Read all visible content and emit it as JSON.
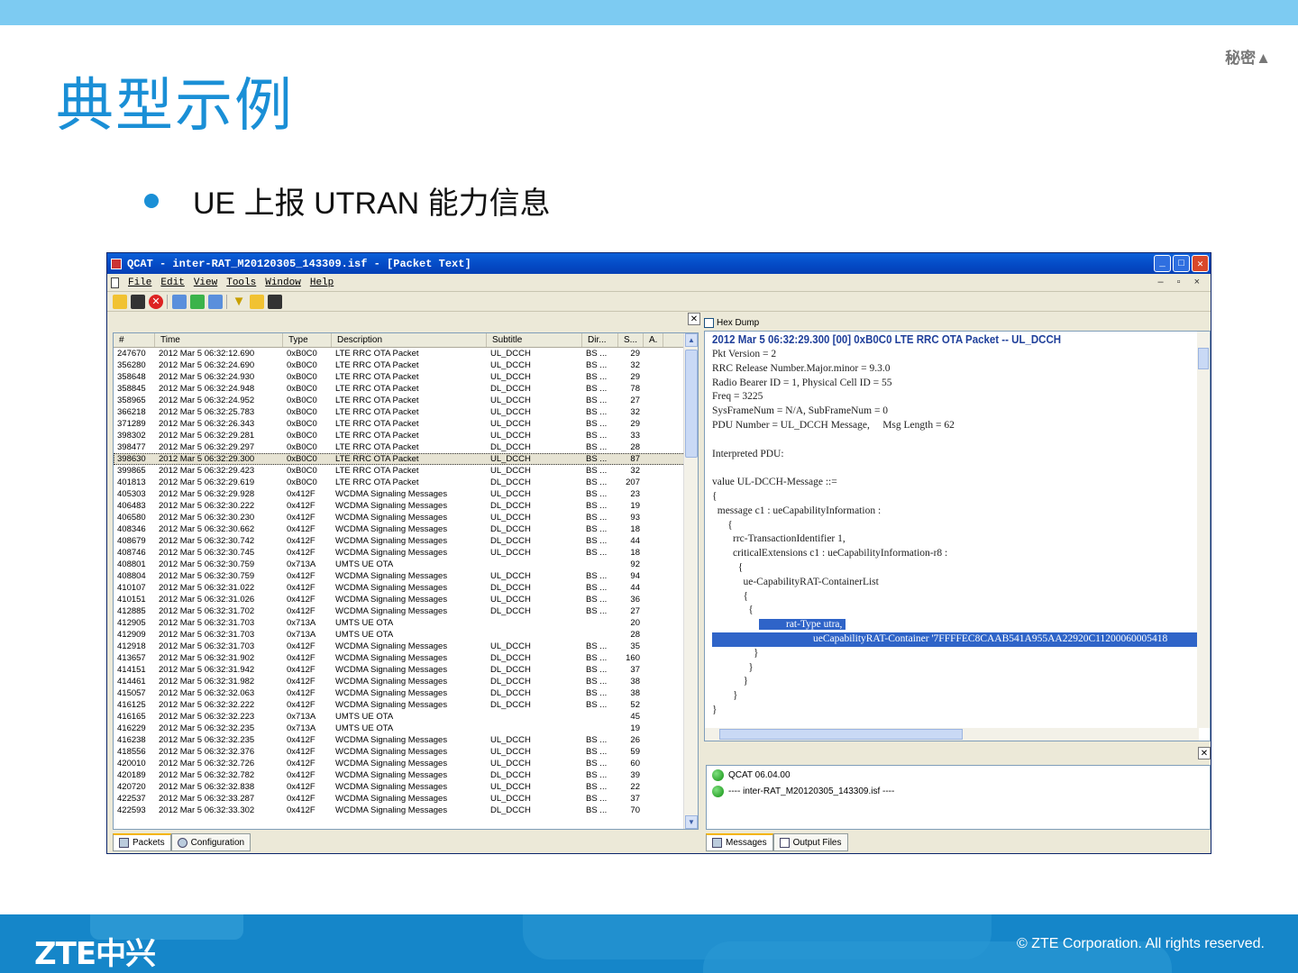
{
  "slide": {
    "classification": "秘密▲",
    "title": "典型示例",
    "bullet": "UE 上报 UTRAN 能力信息",
    "logo": "ZTE中兴",
    "copyright": "© ZTE Corporation. All rights reserved."
  },
  "window": {
    "title": "QCAT - inter-RAT_M20120305_143309.isf - [Packet Text]",
    "menu": [
      "File",
      "Edit",
      "View",
      "Tools",
      "Window",
      "Help"
    ],
    "mdi_controls": "– ▫ ×",
    "win_controls": {
      "minimize": "_",
      "maximize": "□",
      "close": "✕"
    }
  },
  "packets": {
    "columns": [
      "#",
      "Time",
      "Type",
      "Description",
      "Subtitle",
      "Dir...",
      "S...",
      "A."
    ],
    "rows": [
      [
        "247670",
        "2012 Mar  5 06:32:12.690",
        "0xB0C0",
        "LTE RRC OTA Packet",
        "UL_DCCH",
        "BS ...",
        "29"
      ],
      [
        "356280",
        "2012 Mar  5 06:32:24.690",
        "0xB0C0",
        "LTE RRC OTA Packet",
        "UL_DCCH",
        "BS ...",
        "32"
      ],
      [
        "358648",
        "2012 Mar  5 06:32:24.930",
        "0xB0C0",
        "LTE RRC OTA Packet",
        "UL_DCCH",
        "BS ...",
        "29"
      ],
      [
        "358845",
        "2012 Mar  5 06:32:24.948",
        "0xB0C0",
        "LTE RRC OTA Packet",
        "DL_DCCH",
        "BS ...",
        "78"
      ],
      [
        "358965",
        "2012 Mar  5 06:32:24.952",
        "0xB0C0",
        "LTE RRC OTA Packet",
        "UL_DCCH",
        "BS ...",
        "27"
      ],
      [
        "366218",
        "2012 Mar  5 06:32:25.783",
        "0xB0C0",
        "LTE RRC OTA Packet",
        "UL_DCCH",
        "BS ...",
        "32"
      ],
      [
        "371289",
        "2012 Mar  5 06:32:26.343",
        "0xB0C0",
        "LTE RRC OTA Packet",
        "UL_DCCH",
        "BS ...",
        "29"
      ],
      [
        "398302",
        "2012 Mar  5 06:32:29.281",
        "0xB0C0",
        "LTE RRC OTA Packet",
        "UL_DCCH",
        "BS ...",
        "33"
      ],
      [
        "398477",
        "2012 Mar  5 06:32:29.297",
        "0xB0C0",
        "LTE RRC OTA Packet",
        "DL_DCCH",
        "BS ...",
        "28"
      ],
      [
        "398630",
        "2012 Mar  5 06:32:29.300",
        "0xB0C0",
        "LTE RRC OTA Packet",
        "UL_DCCH",
        "BS ...",
        "87"
      ],
      [
        "399865",
        "2012 Mar  5 06:32:29.423",
        "0xB0C0",
        "LTE RRC OTA Packet",
        "UL_DCCH",
        "BS ...",
        "32"
      ],
      [
        "401813",
        "2012 Mar  5 06:32:29.619",
        "0xB0C0",
        "LTE RRC OTA Packet",
        "DL_DCCH",
        "BS ...",
        "207"
      ],
      [
        "405303",
        "2012 Mar  5 06:32:29.928",
        "0x412F",
        "WCDMA Signaling Messages",
        "UL_DCCH",
        "BS ...",
        "23"
      ],
      [
        "406483",
        "2012 Mar  5 06:32:30.222",
        "0x412F",
        "WCDMA Signaling Messages",
        "DL_DCCH",
        "BS ...",
        "19"
      ],
      [
        "406580",
        "2012 Mar  5 06:32:30.230",
        "0x412F",
        "WCDMA Signaling Messages",
        "UL_DCCH",
        "BS ...",
        "93"
      ],
      [
        "408346",
        "2012 Mar  5 06:32:30.662",
        "0x412F",
        "WCDMA Signaling Messages",
        "DL_DCCH",
        "BS ...",
        "18"
      ],
      [
        "408679",
        "2012 Mar  5 06:32:30.742",
        "0x412F",
        "WCDMA Signaling Messages",
        "DL_DCCH",
        "BS ...",
        "44"
      ],
      [
        "408746",
        "2012 Mar  5 06:32:30.745",
        "0x412F",
        "WCDMA Signaling Messages",
        "UL_DCCH",
        "BS ...",
        "18"
      ],
      [
        "408801",
        "2012 Mar  5 06:32:30.759",
        "0x713A",
        "UMTS UE OTA",
        "",
        "",
        "92"
      ],
      [
        "408804",
        "2012 Mar  5 06:32:30.759",
        "0x412F",
        "WCDMA Signaling Messages",
        "UL_DCCH",
        "BS ...",
        "94"
      ],
      [
        "410107",
        "2012 Mar  5 06:32:31.022",
        "0x412F",
        "WCDMA Signaling Messages",
        "DL_DCCH",
        "BS ...",
        "44"
      ],
      [
        "410151",
        "2012 Mar  5 06:32:31.026",
        "0x412F",
        "WCDMA Signaling Messages",
        "UL_DCCH",
        "BS ...",
        "36"
      ],
      [
        "412885",
        "2012 Mar  5 06:32:31.702",
        "0x412F",
        "WCDMA Signaling Messages",
        "DL_DCCH",
        "BS ...",
        "27"
      ],
      [
        "412905",
        "2012 Mar  5 06:32:31.703",
        "0x713A",
        "UMTS UE OTA",
        "",
        "",
        "20"
      ],
      [
        "412909",
        "2012 Mar  5 06:32:31.703",
        "0x713A",
        "UMTS UE OTA",
        "",
        "",
        "28"
      ],
      [
        "412918",
        "2012 Mar  5 06:32:31.703",
        "0x412F",
        "WCDMA Signaling Messages",
        "UL_DCCH",
        "BS ...",
        "35"
      ],
      [
        "413657",
        "2012 Mar  5 06:32:31.902",
        "0x412F",
        "WCDMA Signaling Messages",
        "DL_DCCH",
        "BS ...",
        "160"
      ],
      [
        "414151",
        "2012 Mar  5 06:32:31.942",
        "0x412F",
        "WCDMA Signaling Messages",
        "DL_DCCH",
        "BS ...",
        "37"
      ],
      [
        "414461",
        "2012 Mar  5 06:32:31.982",
        "0x412F",
        "WCDMA Signaling Messages",
        "DL_DCCH",
        "BS ...",
        "38"
      ],
      [
        "415057",
        "2012 Mar  5 06:32:32.063",
        "0x412F",
        "WCDMA Signaling Messages",
        "DL_DCCH",
        "BS ...",
        "38"
      ],
      [
        "416125",
        "2012 Mar  5 06:32:32.222",
        "0x412F",
        "WCDMA Signaling Messages",
        "DL_DCCH",
        "BS ...",
        "52"
      ],
      [
        "416165",
        "2012 Mar  5 06:32:32.223",
        "0x713A",
        "UMTS UE OTA",
        "",
        "",
        "45"
      ],
      [
        "416229",
        "2012 Mar  5 06:32:32.235",
        "0x713A",
        "UMTS UE OTA",
        "",
        "",
        "19"
      ],
      [
        "416238",
        "2012 Mar  5 06:32:32.235",
        "0x412F",
        "WCDMA Signaling Messages",
        "UL_DCCH",
        "BS ...",
        "26"
      ],
      [
        "418556",
        "2012 Mar  5 06:32:32.376",
        "0x412F",
        "WCDMA Signaling Messages",
        "UL_DCCH",
        "BS ...",
        "59"
      ],
      [
        "420010",
        "2012 Mar  5 06:32:32.726",
        "0x412F",
        "WCDMA Signaling Messages",
        "UL_DCCH",
        "BS ...",
        "60"
      ],
      [
        "420189",
        "2012 Mar  5 06:32:32.782",
        "0x412F",
        "WCDMA Signaling Messages",
        "DL_DCCH",
        "BS ...",
        "39"
      ],
      [
        "420720",
        "2012 Mar  5 06:32:32.838",
        "0x412F",
        "WCDMA Signaling Messages",
        "UL_DCCH",
        "BS ...",
        "22"
      ],
      [
        "422537",
        "2012 Mar  5 06:32:33.287",
        "0x412F",
        "WCDMA Signaling Messages",
        "UL_DCCH",
        "BS ...",
        "37"
      ],
      [
        "422593",
        "2012 Mar  5 06:32:33.302",
        "0x412F",
        "WCDMA Signaling Messages",
        "DL_DCCH",
        "BS ...",
        "70"
      ]
    ],
    "selected_index": 9,
    "tabs": [
      "Packets",
      "Configuration"
    ]
  },
  "detail": {
    "hex_dump_label": "Hex Dump",
    "header": "2012 Mar  5  06:32:29.300  [00]  0xB0C0  LTE RRC OTA Packet  --  UL_DCCH",
    "lines_before": [
      "Pkt Version = 2",
      "RRC Release Number.Major.minor = 9.3.0",
      "Radio Bearer ID = 1, Physical Cell ID = 55",
      "Freq = 3225",
      "SysFrameNum = N/A, SubFrameNum = 0",
      "PDU Number = UL_DCCH Message,     Msg Length = 62",
      "",
      "Interpreted PDU:",
      "",
      "value UL-DCCH-Message ::=",
      "{",
      "  message c1 : ueCapabilityInformation :",
      "      {",
      "        rrc-TransactionIdentifier 1,",
      "        criticalExtensions c1 : ueCapabilityInformation-r8 :",
      "          {",
      "            ue-CapabilityRAT-ContainerList",
      "            {",
      "              {"
    ],
    "hl_line1": "rat-Type utra,",
    "hl_line2_pre": "",
    "hl_line2": "ueCapabilityRAT-Container '7FFFFEC8CAAB541A955AA22920C11200060005418",
    "lines_after": [
      "                }",
      "              }",
      "            }",
      "        }",
      "}"
    ]
  },
  "messages": {
    "items": [
      "QCAT 06.04.00",
      "---- inter-RAT_M20120305_143309.isf ----"
    ],
    "tabs": [
      "Messages",
      "Output Files"
    ]
  },
  "colors": {
    "accent": "#1a8fd6",
    "footer": "#1586c9",
    "topbar": "#7dcbf2",
    "highlight": "#2f64c8"
  }
}
